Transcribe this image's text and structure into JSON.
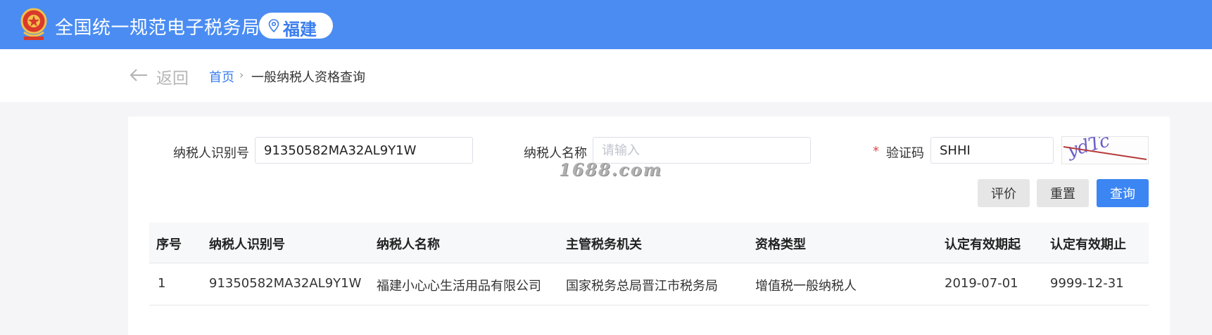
{
  "header": {
    "title": "全国统一规范电子税务局",
    "region": "福建",
    "brand_color": "#4a8cf2"
  },
  "nav": {
    "back_label": "返回",
    "breadcrumb_home": "首页",
    "breadcrumb_separator": "›",
    "breadcrumb_current": "一般纳税人资格查询"
  },
  "form": {
    "taxpayer_id_label": "纳税人识别号",
    "taxpayer_id_value": "91350582MA32AL9Y1W",
    "taxpayer_name_label": "纳税人名称",
    "taxpayer_name_placeholder": "请输入",
    "required_mark": "*",
    "captcha_label": "验证码",
    "captcha_value": "SHHI",
    "captcha_image_text": "ydTc",
    "evaluate_label": "评价",
    "reset_label": "重置",
    "query_label": "查询"
  },
  "watermark": "1688.com",
  "table": {
    "columns": [
      "序号",
      "纳税人识别号",
      "纳税人名称",
      "主管税务机关",
      "资格类型",
      "认定有效期起",
      "认定有效期止"
    ],
    "rows": [
      [
        "1",
        "91350582MA32AL9Y1W",
        "福建小心心生活用品有限公司",
        "国家税务总局晋江市税务局",
        "增值税一般纳税人",
        "2019-07-01",
        "9999-12-31"
      ]
    ]
  }
}
